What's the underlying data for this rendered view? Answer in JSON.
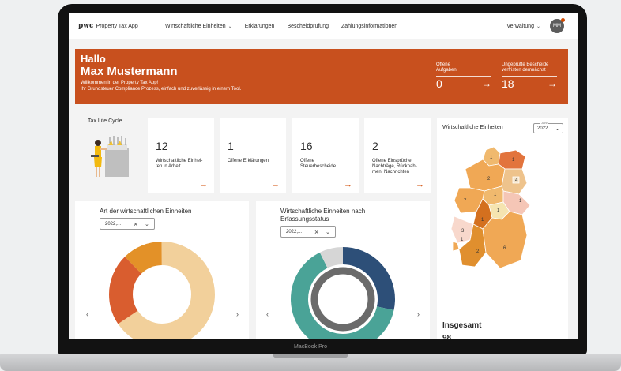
{
  "nav": {
    "logo": "pwc",
    "app_name": "Property Tax App",
    "items": [
      {
        "label": "Wirtschaftliche Einheiten",
        "dropdown": true
      },
      {
        "label": "Erklärungen",
        "dropdown": false
      },
      {
        "label": "Bescheidprüfung",
        "dropdown": false
      },
      {
        "label": "Zahlungsinformationen",
        "dropdown": false
      }
    ],
    "admin_menu": "Verwaltung",
    "avatar_initials": "MM"
  },
  "hero": {
    "greeting": "Hallo",
    "name": "Max Mustermann",
    "subtitle_1": "Willkommen in der Property Tax App!",
    "subtitle_2": "Ihr Grundsteuer Compliance Prozess, einfach und zuverlässig in einem Tool.",
    "kpis": [
      {
        "label_1": "Offene",
        "label_2": "Aufgaben",
        "value": "0"
      },
      {
        "label_1": "Ungeprüfte Bescheide",
        "label_2": "verfristen demnächst",
        "value": "18"
      }
    ],
    "color": "#c8501e"
  },
  "lifecycle": {
    "title": "Tax Life Cycle"
  },
  "cards": [
    {
      "value": "12",
      "label_1": "Wirtschaftliche Einhei-",
      "label_2": "ten in Arbeit",
      "label_3": "",
      "label_4": ""
    },
    {
      "value": "1",
      "label_1": "Offene Erklärungen",
      "label_2": "",
      "label_3": "",
      "label_4": ""
    },
    {
      "value": "16",
      "label_1": "Offene",
      "label_2": "Steuerbescheide",
      "label_3": "",
      "label_4": ""
    },
    {
      "value": "2",
      "label_1": "Offene Einsprüche,",
      "label_2": "Nachträge, Rücknah-",
      "label_3": "men, Nachrichten",
      "label_4": ""
    }
  ],
  "map": {
    "title": "Wirtschaftliche Einheiten",
    "year_label": "Jahr",
    "year_value": "2022",
    "total_label": "Insgesamt",
    "total_value": "98",
    "region_labels": [
      "1",
      "1",
      "4",
      "2",
      "1",
      "1",
      "7",
      "1",
      "3",
      "1",
      "6",
      "2",
      "1"
    ]
  },
  "chart_left": {
    "title": "Art der wirtschaftlichen Einheiten",
    "filter_value": "2022,...",
    "colors": [
      "#f2d09b",
      "#d95d2f",
      "#e39128"
    ]
  },
  "chart_right": {
    "title_1": "Wirtschaftliche Einheiten nach",
    "title_2": "Erfassungsstatus",
    "filter_value": "2022,...",
    "colors": [
      "#2d4f78",
      "#4aa397",
      "#d6d6d6",
      "#6b6b6b"
    ]
  },
  "device": {
    "label": "MacBook Pro"
  }
}
